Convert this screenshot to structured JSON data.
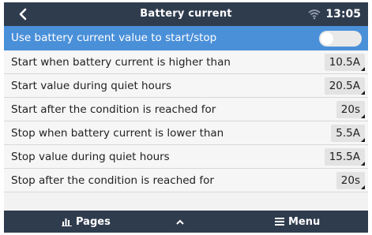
{
  "header": {
    "title": "Battery current",
    "time": "13:05"
  },
  "rows": [
    {
      "label": "Use battery current value to start/stop",
      "toggle_on": false
    },
    {
      "label": "Start when battery current is higher than",
      "value": "10.5A"
    },
    {
      "label": "Start value during quiet hours",
      "value": "20.5A"
    },
    {
      "label": "Start after the condition is reached for",
      "value": "20s"
    },
    {
      "label": "Stop when battery current is lower than",
      "value": "5.5A"
    },
    {
      "label": "Stop value during quiet hours",
      "value": "15.5A"
    },
    {
      "label": "Stop after the condition is reached for",
      "value": "20s"
    }
  ],
  "footer": {
    "pages_label": "Pages",
    "menu_label": "Menu"
  },
  "colors": {
    "header_bg": "#2f3c4e",
    "selected_row": "#4a90d9",
    "row_bg": "#f6f6f6",
    "value_box": "#e3e3e3"
  },
  "icons": {
    "back": "chevron-left-icon",
    "wifi": "wifi-icon",
    "pages": "bar-chart-icon",
    "up": "chevron-up-icon",
    "menu": "hamburger-icon"
  }
}
